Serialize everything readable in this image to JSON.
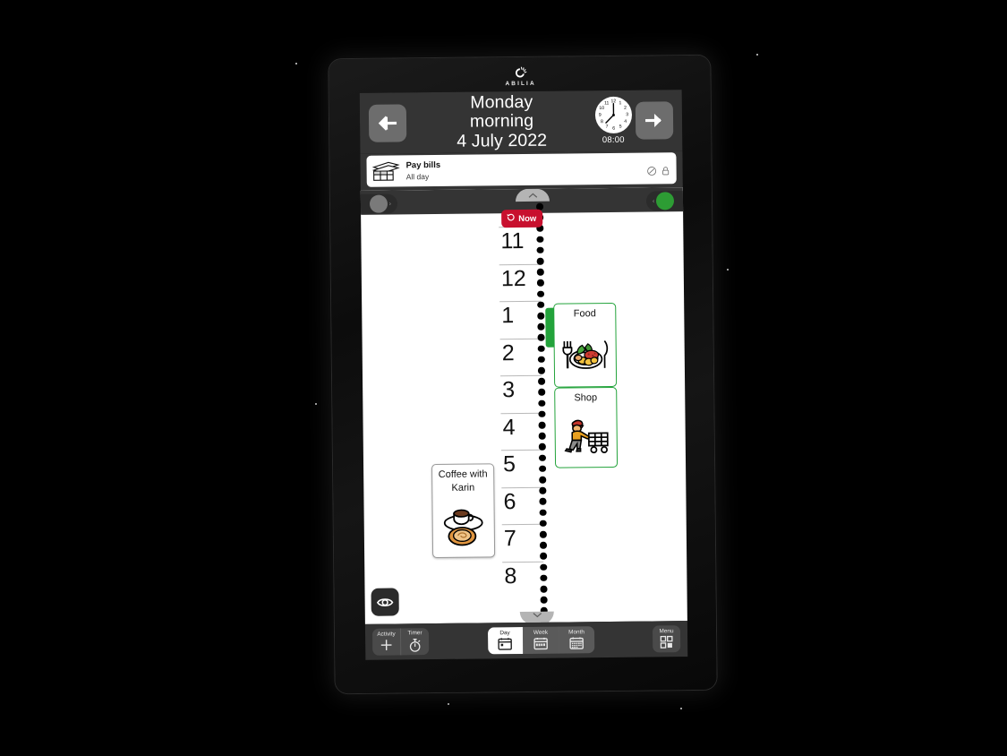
{
  "brand": {
    "name": "ABILIA",
    "logo_icon": "abilia-logo-icon"
  },
  "header": {
    "back_icon": "arrow-left-icon",
    "forward_icon": "arrow-right-icon",
    "title_line1": "Monday",
    "title_line2": "morning",
    "title_line3": "4 July 2022",
    "clock_icon": "analog-clock-icon",
    "clock_time": "08:00",
    "clock_hour": 8,
    "clock_minute": 0,
    "clock_numerals": [
      "12",
      "1",
      "2",
      "3",
      "4",
      "5",
      "6",
      "7",
      "8",
      "9",
      "10",
      "11"
    ],
    "bg_color": "#343434"
  },
  "all_day": {
    "icon": "bills-icon",
    "title": "Pay bills",
    "subtitle": "All day",
    "check_icon": "check-circle-icon",
    "lock_icon": "lock-icon"
  },
  "timeline": {
    "now_label": "Now",
    "now_icon": "history-revert-icon",
    "now_color": "#c8102e",
    "scroll_up_icon": "chevron-up-icon",
    "scroll_down_icon": "chevron-down-icon",
    "left_indicator_color": "#7a7a7a",
    "right_indicator_color": "#2d9c34",
    "left_caret_icon": "chevron-right-icon",
    "right_caret_icon": "chevron-left-icon",
    "hours": [
      "11",
      "12",
      "1",
      "2",
      "3",
      "4",
      "5",
      "6",
      "7",
      "8"
    ],
    "eye_icon": "eye-icon",
    "activities": [
      {
        "name": "Food",
        "icon": "meal-plate-icon",
        "side": "right",
        "border_color": "#23a33b",
        "has_timebar": true,
        "timebar_color": "#23a33b"
      },
      {
        "name": "Shop",
        "icon": "shopping-cart-person-icon",
        "side": "right",
        "border_color": "#23a33b",
        "has_timebar": false
      },
      {
        "name": "Coffee with Karin",
        "icon": "coffee-cup-bun-icon",
        "side": "left",
        "border_color": "#9a9a9a",
        "has_timebar": false
      }
    ]
  },
  "toolbar": {
    "activity_label": "Activity",
    "activity_icon": "plus-icon",
    "timer_label": "Timer",
    "timer_icon": "stopwatch-icon",
    "day_label": "Day",
    "day_icon": "calendar-day-icon",
    "week_label": "Week",
    "week_icon": "calendar-week-icon",
    "month_label": "Month",
    "month_icon": "calendar-month-icon",
    "menu_label": "Menu",
    "menu_icon": "grid-squares-icon",
    "active_view": "Day"
  }
}
